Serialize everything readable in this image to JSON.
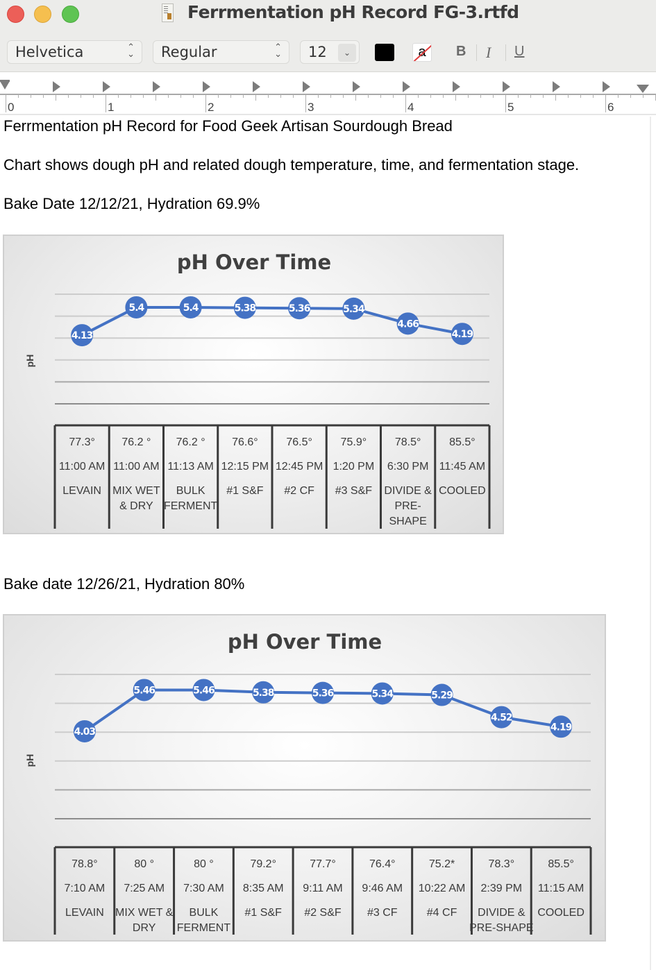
{
  "window": {
    "title": "Ferrmentation pH Record FG-3.rtfd",
    "doc_icon": "rtfd-document-icon"
  },
  "toolbar": {
    "font_family": "Helvetica",
    "font_style": "Regular",
    "font_size": "12",
    "text_color": "#000000",
    "bold_label": "B",
    "italic_label": "I",
    "underline_label": "U",
    "background_color_glyph": "a"
  },
  "ruler": {
    "numbers": [
      "0",
      "1",
      "2",
      "3",
      "4",
      "5",
      "6"
    ]
  },
  "document": {
    "heading": "Ferrmentation pH Record for Food Geek Artisan Sourdough Bread",
    "description": "Chart shows dough pH and related dough temperature, time, and fermentation stage.",
    "bake1_label": "Bake Date 12/12/21, Hydration 69.9%",
    "bake2_label": "Bake date 12/26/21, Hydration 80%"
  },
  "chart_data": [
    {
      "type": "line",
      "title": "pH Over Time",
      "xlabel": "",
      "ylabel": "pH",
      "ylim": [
        1,
        6
      ],
      "grid": true,
      "legend": "none",
      "line_color": "#4472c4",
      "categories": [
        "LEVAIN",
        "MIX WET & DRY",
        "BULK FERMENT",
        "#1 S&F",
        "#2 CF",
        "#3 S&F",
        "DIVIDE & PRE-SHAPE",
        "COOLED"
      ],
      "values": [
        4.13,
        5.4,
        5.4,
        5.38,
        5.36,
        5.34,
        4.66,
        4.19
      ],
      "data_labels": [
        "4.13",
        "5.4",
        "5.4",
        "5.38",
        "5.36",
        "5.34",
        "4.66",
        "4.19"
      ],
      "table": {
        "temperatures": [
          "77.3°",
          "76.2 °",
          "76.2 °",
          "76.6°",
          "76.5°",
          "75.9°",
          "78.5°",
          "85.5°"
        ],
        "times": [
          "11:00 AM",
          "11:00 AM",
          "11:13 AM",
          "12:15 PM",
          "12:45 PM",
          "1:20 PM",
          "6:30 PM",
          "11:45 AM"
        ],
        "stages": [
          [
            "LEVAIN"
          ],
          [
            "MIX WET",
            "& DRY"
          ],
          [
            "BULK",
            "FERMENT"
          ],
          [
            "#1 S&F"
          ],
          [
            "#2 CF"
          ],
          [
            "#3 S&F"
          ],
          [
            "DIVIDE &",
            "PRE-",
            "SHAPE"
          ],
          [
            "COOLED"
          ]
        ]
      }
    },
    {
      "type": "line",
      "title": "pH Over Time",
      "xlabel": "",
      "ylabel": "pH",
      "ylim": [
        1,
        6
      ],
      "grid": true,
      "legend": "none",
      "line_color": "#4472c4",
      "categories": [
        "LEVAIN",
        "MIX WET & DRY",
        "BULK FERMENT",
        "#1 S&F",
        "#2 S&F",
        "#3 CF",
        "#4 CF",
        "DIVIDE & PRE-SHAPE",
        "COOLED"
      ],
      "values": [
        4.03,
        5.46,
        5.46,
        5.38,
        5.36,
        5.34,
        5.29,
        4.52,
        4.19
      ],
      "data_labels": [
        "4.03",
        "5.46",
        "5.46",
        "5.38",
        "5.36",
        "5.34",
        "5.29",
        "4.52",
        "4.19"
      ],
      "table": {
        "temperatures": [
          "78.8°",
          "80 °",
          "80 °",
          "79.2°",
          "77.7°",
          "76.4°",
          "75.2*",
          "78.3°",
          "85.5°"
        ],
        "times": [
          "7:10 AM",
          "7:25 AM",
          "7:30 AM",
          "8:35 AM",
          "9:11 AM",
          "9:46 AM",
          "10:22 AM",
          "2:39 PM",
          "11:15 AM"
        ],
        "stages": [
          [
            "LEVAIN"
          ],
          [
            "MIX WET &",
            "DRY"
          ],
          [
            "BULK",
            "FERMENT"
          ],
          [
            "#1 S&F"
          ],
          [
            "#2 S&F"
          ],
          [
            "#3 CF"
          ],
          [
            "#4 CF"
          ],
          [
            "DIVIDE &",
            "PRE-SHAPE"
          ],
          [
            "COOLED"
          ]
        ]
      }
    }
  ]
}
